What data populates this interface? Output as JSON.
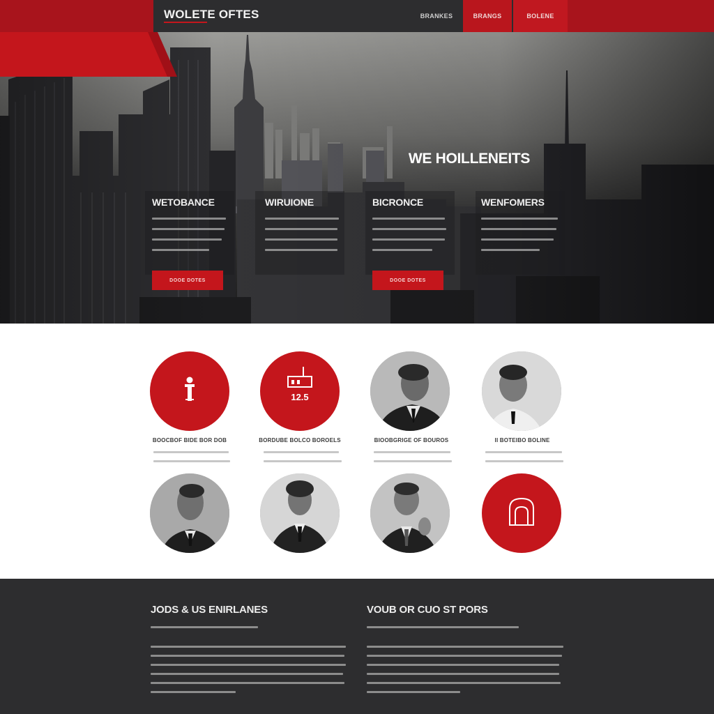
{
  "header": {
    "logo": "WOLETE OFTES",
    "nav": [
      "BRANKES",
      "BRANGS",
      "BOLENE"
    ]
  },
  "hero": {
    "banner": "WE HOILLENEITS",
    "columns": [
      {
        "title": "WETOBANCE",
        "button": "DOOE DOTES"
      },
      {
        "title": "WIRUIONE",
        "button": ""
      },
      {
        "title": "BICRONCE",
        "button": "DOOE DOTES"
      },
      {
        "title": "WENFOMERS",
        "button": ""
      }
    ]
  },
  "team": {
    "icons": [
      "person-icon",
      "building-icon",
      "portrait-photo",
      "portrait-photo",
      "portrait-photo",
      "portrait-photo",
      "portrait-photo",
      "lock-icon"
    ],
    "building_label": "12.5",
    "members": [
      "BOOCBOF BIDE BOR DOB",
      "BORDUBE BOLCO BOROELS",
      "BIOOBGRIGE OF BOUROS",
      "II BOTEIBO BOLINE"
    ]
  },
  "footer": {
    "col1_title": "JODS & US ENIRLANES",
    "col2_title": "VOUB OR CUO ST PORS"
  },
  "colors": {
    "accent": "#c4161c",
    "dark": "#2d2d2f"
  }
}
